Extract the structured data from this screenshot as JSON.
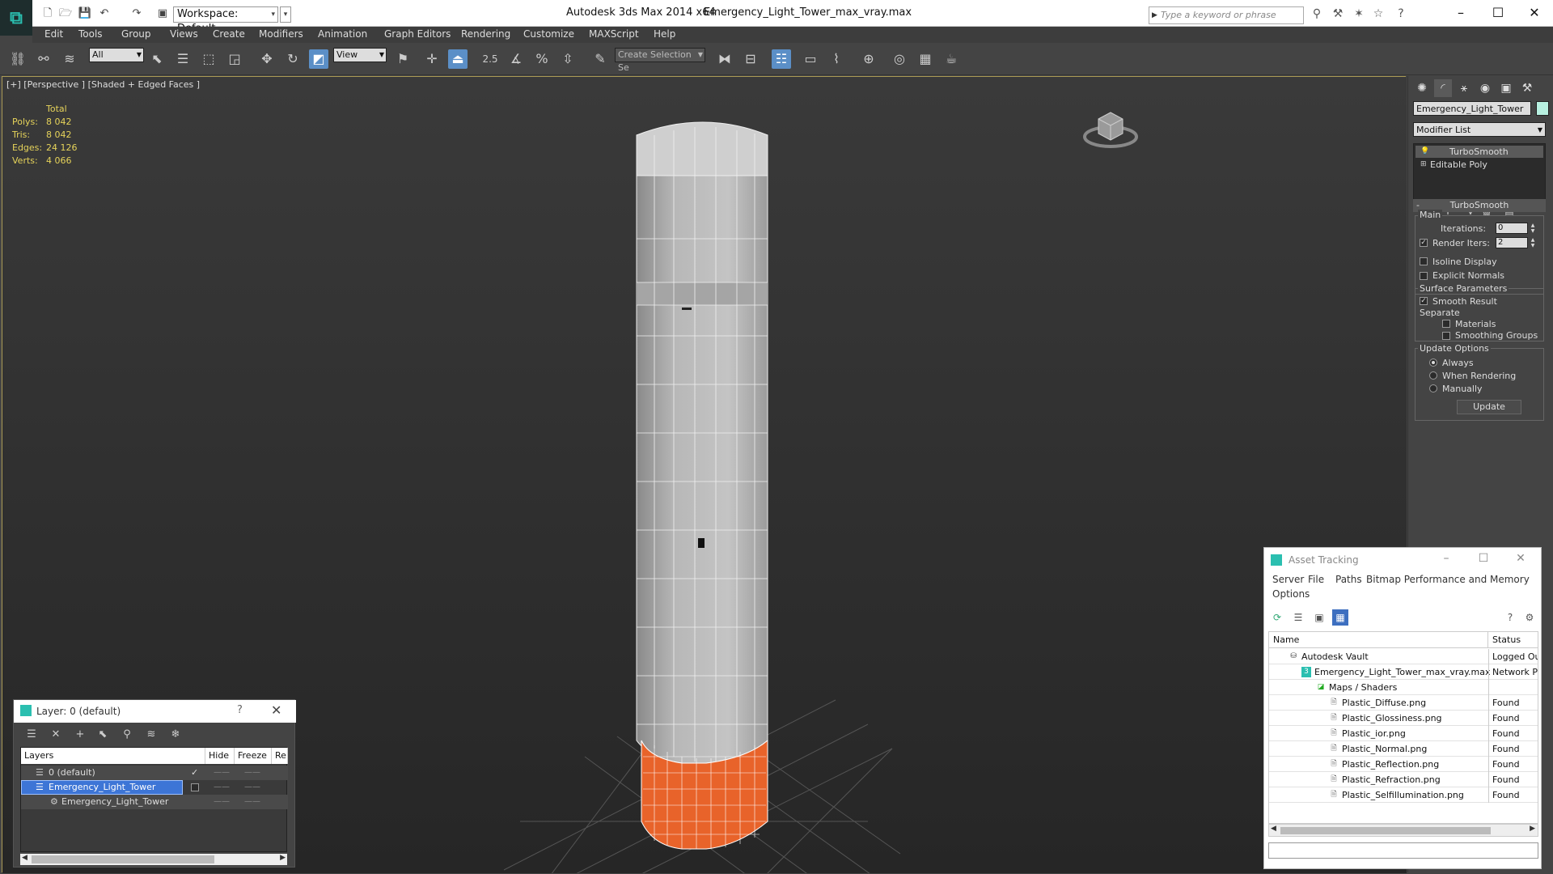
{
  "app": {
    "title": "Autodesk 3ds Max  2014 x64",
    "file": "Emergency_Light_Tower_max_vray.max",
    "workspace": "Workspace: Default",
    "search_placeholder": "Type a keyword or phrase"
  },
  "menu": [
    "Edit",
    "Tools",
    "Group",
    "Views",
    "Create",
    "Modifiers",
    "Animation",
    "Graph Editors",
    "Rendering",
    "Customize",
    "MAXScript",
    "Help"
  ],
  "toolbar": {
    "selection_filter": "All",
    "ref_coord": "View",
    "snap_label": "2.5",
    "named_selection": "Create Selection Se"
  },
  "viewport": {
    "label": "[+] [Perspective ] [Shaded + Edged Faces ]",
    "stats_header": "Total",
    "stats": [
      {
        "label": "Polys:",
        "value": "8 042"
      },
      {
        "label": "Tris:",
        "value": "8 042"
      },
      {
        "label": "Edges:",
        "value": "24 126"
      },
      {
        "label": "Verts:",
        "value": "4 066"
      }
    ],
    "stats_color": "#e6d35a",
    "selection_color": "#e8632a"
  },
  "command_panel": {
    "object_name": "Emergency_Light_Tower",
    "object_color": "#b7f0e0",
    "modifier_list": "Modifier List",
    "stack": [
      {
        "label": "TurboSmooth",
        "selected": true
      },
      {
        "label": "Editable Poly",
        "selected": false
      }
    ],
    "rollout_title": "TurboSmooth",
    "main_group": "Main",
    "iterations_label": "Iterations:",
    "iterations_value": "0",
    "render_iters_label": "Render Iters:",
    "render_iters_value": "2",
    "render_iters_checked": true,
    "isoline_label": "Isoline Display",
    "explicit_normals_label": "Explicit Normals",
    "surface_group": "Surface Parameters",
    "smooth_result_label": "Smooth Result",
    "separate_label": "Separate",
    "materials_label": "Materials",
    "smoothing_groups_label": "Smoothing Groups",
    "update_group": "Update Options",
    "update_options": [
      "Always",
      "When Rendering",
      "Manually"
    ],
    "update_button": "Update"
  },
  "layer_window": {
    "title": "Layer: 0 (default)",
    "columns": [
      "Layers",
      "Hide",
      "Freeze",
      "Re"
    ],
    "rows": [
      {
        "name": "0 (default)",
        "selected": false
      },
      {
        "name": "Emergency_Light_Tower",
        "selected": true
      },
      {
        "name": "Emergency_Light_Tower",
        "selected": false
      }
    ]
  },
  "asset_window": {
    "title": "Asset Tracking",
    "menu": [
      "Server",
      "File",
      "Paths",
      "Bitmap Performance and Memory",
      "Options"
    ],
    "columns": [
      "Name",
      "Status"
    ],
    "rows": [
      {
        "name": "Autodesk Vault",
        "status": "Logged Ou"
      },
      {
        "name": "Emergency_Light_Tower_max_vray.max",
        "status": "Network Pa"
      },
      {
        "name": "Maps / Shaders",
        "status": ""
      },
      {
        "name": "Plastic_Diffuse.png",
        "status": "Found"
      },
      {
        "name": "Plastic_Glossiness.png",
        "status": "Found"
      },
      {
        "name": "Plastic_ior.png",
        "status": "Found"
      },
      {
        "name": "Plastic_Normal.png",
        "status": "Found"
      },
      {
        "name": "Plastic_Reflection.png",
        "status": "Found"
      },
      {
        "name": "Plastic_Refraction.png",
        "status": "Found"
      },
      {
        "name": "Plastic_Selfillumination.png",
        "status": "Found"
      }
    ]
  }
}
